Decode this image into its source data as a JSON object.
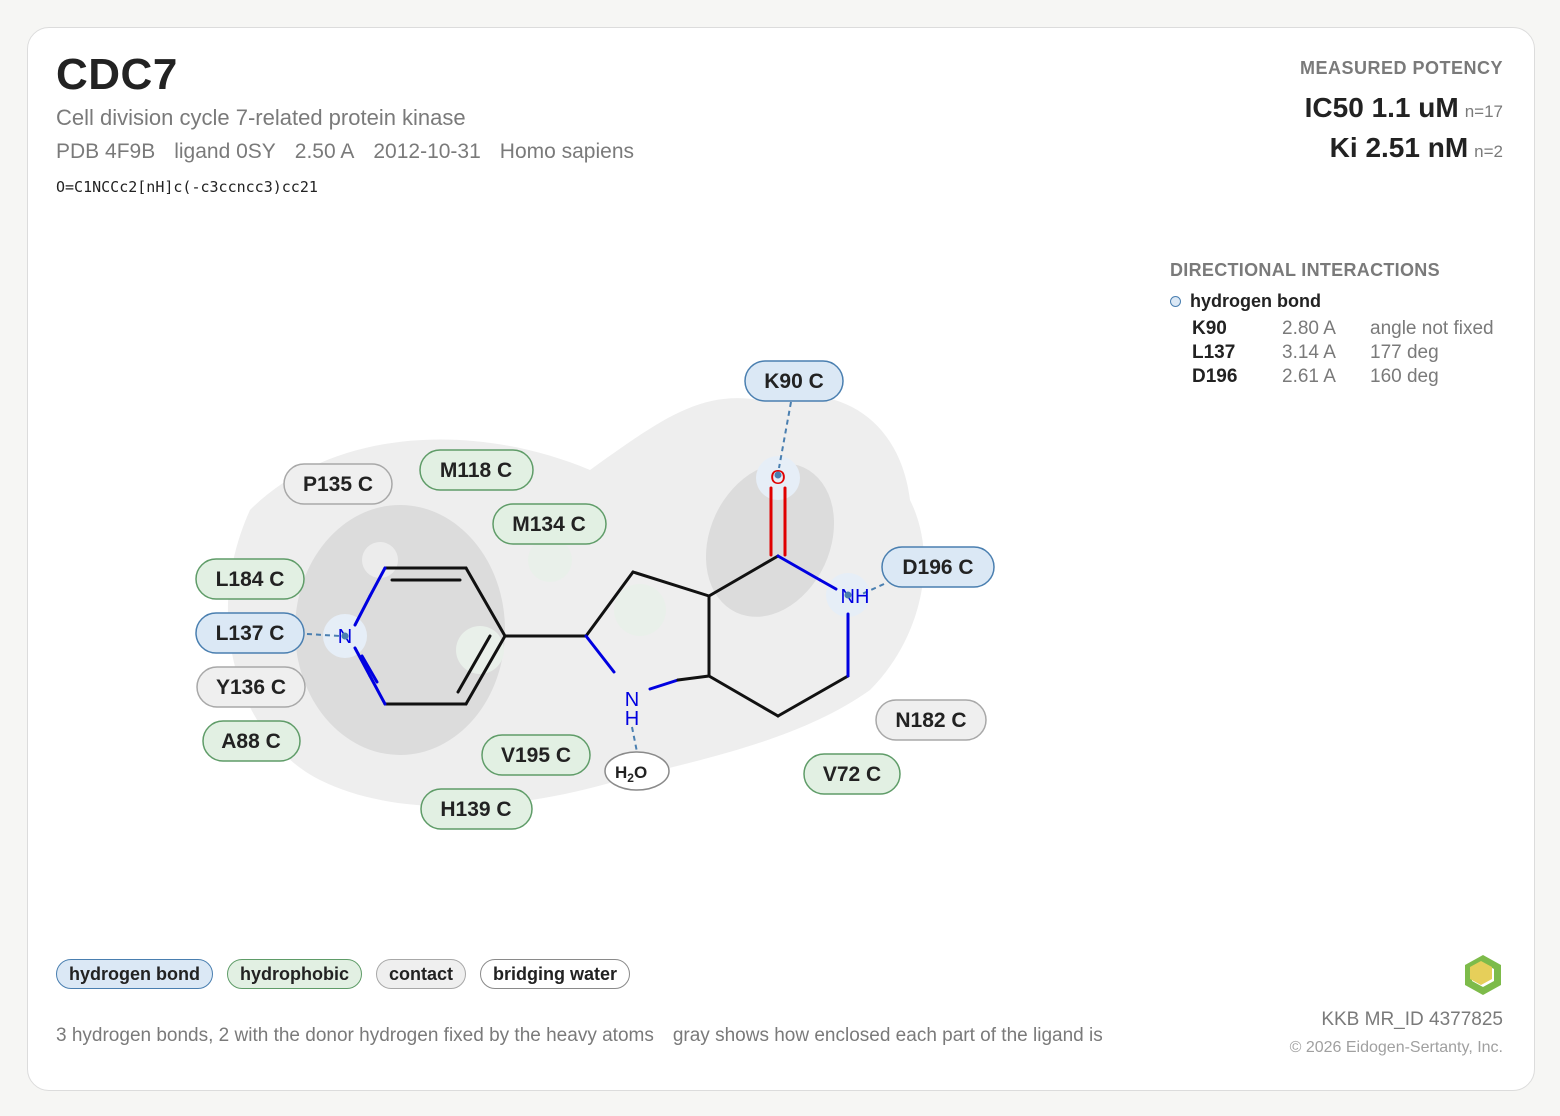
{
  "header": {
    "title": "CDC7",
    "subtitle": "Cell division cycle 7-related protein kinase",
    "meta": [
      "PDB 4F9B",
      "ligand 0SY",
      "2.50 A",
      "2012-10-31",
      "Homo sapiens"
    ],
    "smiles": "O=C1NCCc2[nH]c(-c3ccncc3)cc21"
  },
  "potency": {
    "heading": "MEASURED POTENCY",
    "rows": [
      {
        "label": "IC50 1.1 uM",
        "n": "n=17"
      },
      {
        "label": "Ki 2.51 nM",
        "n": "n=2"
      }
    ]
  },
  "directional": {
    "heading": "DIRECTIONAL INTERACTIONS",
    "type": "hydrogen bond",
    "rows": [
      {
        "residue": "K90",
        "distance": "2.80 A",
        "angle": "angle not fixed"
      },
      {
        "residue": "L137",
        "distance": "3.14 A",
        "angle": "177 deg"
      },
      {
        "residue": "D196",
        "distance": "2.61 A",
        "angle": "160 deg"
      }
    ]
  },
  "residues": [
    {
      "label": "K90 C",
      "kind": "hbond"
    },
    {
      "label": "M118 C",
      "kind": "hydrophobic"
    },
    {
      "label": "P135 C",
      "kind": "contact"
    },
    {
      "label": "M134 C",
      "kind": "hydrophobic"
    },
    {
      "label": "L184 C",
      "kind": "hydrophobic"
    },
    {
      "label": "L137 C",
      "kind": "hbond"
    },
    {
      "label": "Y136 C",
      "kind": "contact"
    },
    {
      "label": "A88 C",
      "kind": "hydrophobic"
    },
    {
      "label": "D196 C",
      "kind": "hbond"
    },
    {
      "label": "N182 C",
      "kind": "contact"
    },
    {
      "label": "V72 C",
      "kind": "hydrophobic"
    },
    {
      "label": "V195 C",
      "kind": "hydrophobic"
    },
    {
      "label": "H139 C",
      "kind": "hydrophobic"
    }
  ],
  "atoms": {
    "o": "O",
    "n_pyr": "N",
    "nh_amide": "NH",
    "n_pyrrole": "N",
    "h_pyrrole": "H",
    "water": "H",
    "water_sub": "2",
    "water_o": "O"
  },
  "legend": [
    "hydrogen bond",
    "hydrophobic",
    "contact",
    "bridging water"
  ],
  "footnotes": [
    "3 hydrogen bonds, 2 with the donor hydrogen fixed by the heavy atoms",
    "gray shows how enclosed each part of the ligand is"
  ],
  "footer": {
    "mr_id": "KKB MR_ID 4377825",
    "copyright": "© 2026 Eidogen-Sertanty, Inc."
  },
  "colors": {
    "hbond_fill": "#dbe8f5",
    "hbond_stroke": "#4a7fb0",
    "hydrophobic_fill": "#e2f0e3",
    "hydrophobic_stroke": "#5f9c68",
    "contact_fill": "#efefef",
    "contact_stroke": "#a8a8a8",
    "oxygen": "#e00000",
    "nitrogen": "#0000e0"
  }
}
